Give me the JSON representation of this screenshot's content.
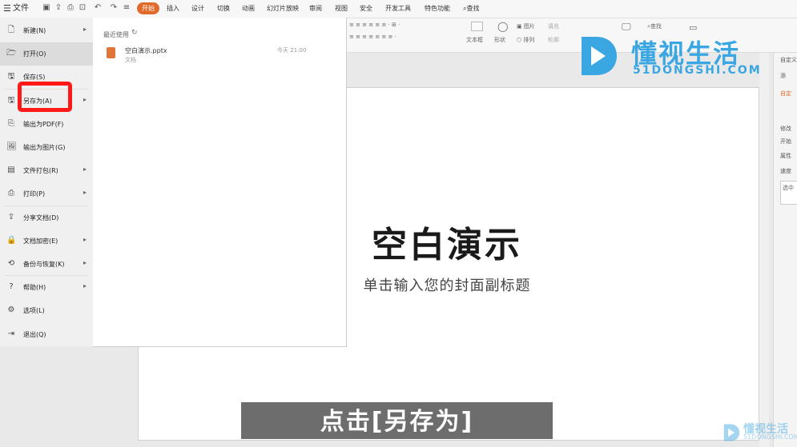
{
  "toolbar": {
    "file_label": "文件",
    "tabs": [
      "开始",
      "插入",
      "设计",
      "切换",
      "动画",
      "幻灯片放映",
      "审阅",
      "视图",
      "安全",
      "开发工具",
      "特色功能"
    ],
    "search_label": "查找"
  },
  "ribbon": {
    "textbox": "文本框",
    "shape": "形状",
    "picture": "图片",
    "arrange": "排列",
    "fill": "填充",
    "outline": "轮廓",
    "find": "查找"
  },
  "file_menu": {
    "items": [
      {
        "label": "新建(N)",
        "icon": "new-file-icon",
        "has_arrow": true
      },
      {
        "label": "打开(O)",
        "icon": "folder-open-icon",
        "has_arrow": false
      },
      {
        "label": "保存(S)",
        "icon": "save-icon",
        "has_arrow": false
      },
      {
        "label": "另存为(A)",
        "icon": "save-as-icon",
        "has_arrow": true
      },
      {
        "label": "输出为PDF(F)",
        "icon": "pdf-icon",
        "has_arrow": false
      },
      {
        "label": "输出为图片(G)",
        "icon": "image-icon",
        "has_arrow": false
      },
      {
        "label": "文件打包(R)",
        "icon": "package-icon",
        "has_arrow": true
      },
      {
        "label": "打印(P)",
        "icon": "print-icon",
        "has_arrow": true
      },
      {
        "label": "分享文档(D)",
        "icon": "share-icon",
        "has_arrow": false
      },
      {
        "label": "文档加密(E)",
        "icon": "lock-icon",
        "has_arrow": true
      },
      {
        "label": "备份与恢复(K)",
        "icon": "backup-icon",
        "has_arrow": true
      },
      {
        "label": "帮助(H)",
        "icon": "help-icon",
        "has_arrow": true
      },
      {
        "label": "选项(L)",
        "icon": "gear-icon",
        "has_arrow": false
      },
      {
        "label": "退出(Q)",
        "icon": "exit-icon",
        "has_arrow": false
      }
    ]
  },
  "recent": {
    "heading": "最近使用",
    "files": [
      {
        "name": "空白演示.pptx",
        "location": "文档",
        "time": "今天 21:00"
      }
    ]
  },
  "slide": {
    "title": "空白演示",
    "subtitle": "单击输入您的封面副标题"
  },
  "right_pane": {
    "title": "自定义",
    "lines": [
      "添",
      "自定",
      "修改",
      "开始",
      "属性",
      "速度"
    ],
    "box_text": "选中"
  },
  "watermark": {
    "brand_cn": "懂视生活",
    "brand_en": "51DONGSHI.COM"
  },
  "caption": "点击[另存为]",
  "colors": {
    "accent": "#e06a2a",
    "highlight_box": "#ff1a1a",
    "watermark": "#3aa6e2"
  }
}
